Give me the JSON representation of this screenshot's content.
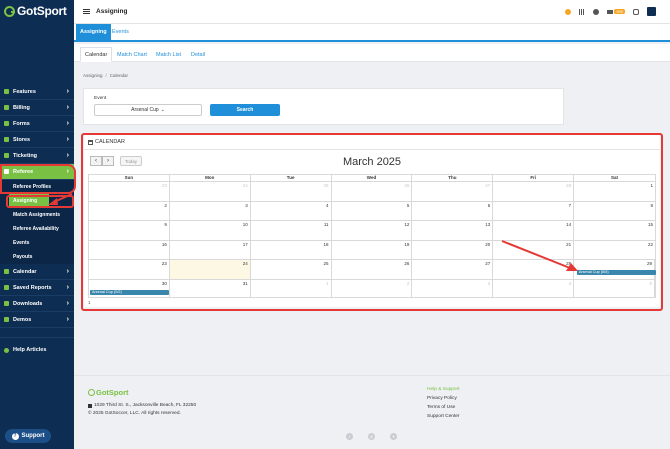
{
  "brand": {
    "name": "GotSport"
  },
  "sidebar": {
    "items": [
      {
        "label": "Features"
      },
      {
        "label": "Billing"
      },
      {
        "label": "Forms"
      },
      {
        "label": "Stores"
      },
      {
        "label": "Ticketing"
      },
      {
        "label": "Referee"
      },
      {
        "label": "Calendar"
      },
      {
        "label": "Saved Reports"
      },
      {
        "label": "Downloads"
      },
      {
        "label": "Demos"
      }
    ],
    "referee_sub": [
      {
        "label": "Referee Profiles"
      },
      {
        "label": "Assigning"
      },
      {
        "label": "Match Assignments"
      },
      {
        "label": "Referee Availability"
      },
      {
        "label": "Events"
      },
      {
        "label": "Payouts"
      }
    ],
    "help": "Help Articles",
    "support": "Support"
  },
  "topbar": {
    "title": "Assigning",
    "mail_badge": "999"
  },
  "tabs_primary": [
    {
      "label": "Assigning"
    },
    {
      "label": "Events"
    }
  ],
  "tabs_secondary": [
    {
      "label": "Calendar"
    },
    {
      "label": "Match Chart"
    },
    {
      "label": "Match List"
    },
    {
      "label": "Detail"
    }
  ],
  "breadcrumb": [
    "Assigning",
    "Calendar"
  ],
  "event_filter": {
    "label": "Event",
    "selected": "Arsenal Cup",
    "search_label": "Search"
  },
  "calendar": {
    "heading": "CALENDAR",
    "prev": "‹",
    "next": "›",
    "today_label": "Today",
    "month_title": "March 2025",
    "days_of_week": [
      "Sun",
      "Mon",
      "Tue",
      "Wed",
      "Thu",
      "Fri",
      "Sat"
    ],
    "weeks": [
      [
        {
          "d": "23",
          "o": true
        },
        {
          "d": "24",
          "o": true
        },
        {
          "d": "25",
          "o": true
        },
        {
          "d": "26",
          "o": true
        },
        {
          "d": "27",
          "o": true
        },
        {
          "d": "28",
          "o": true
        },
        {
          "d": "1"
        }
      ],
      [
        {
          "d": "2"
        },
        {
          "d": "3"
        },
        {
          "d": "4"
        },
        {
          "d": "5"
        },
        {
          "d": "6"
        },
        {
          "d": "7"
        },
        {
          "d": "8"
        }
      ],
      [
        {
          "d": "9"
        },
        {
          "d": "10"
        },
        {
          "d": "11"
        },
        {
          "d": "12"
        },
        {
          "d": "13"
        },
        {
          "d": "14"
        },
        {
          "d": "15"
        }
      ],
      [
        {
          "d": "16"
        },
        {
          "d": "17"
        },
        {
          "d": "18"
        },
        {
          "d": "19"
        },
        {
          "d": "20"
        },
        {
          "d": "21"
        },
        {
          "d": "22"
        }
      ],
      [
        {
          "d": "23"
        },
        {
          "d": "24",
          "t": true
        },
        {
          "d": "25"
        },
        {
          "d": "26"
        },
        {
          "d": "27"
        },
        {
          "d": "28"
        },
        {
          "d": "29"
        }
      ],
      [
        {
          "d": "30"
        },
        {
          "d": "31"
        },
        {
          "d": "1",
          "o": true
        },
        {
          "d": "2",
          "o": true
        },
        {
          "d": "3",
          "o": true
        },
        {
          "d": "4",
          "o": true
        },
        {
          "d": "5",
          "o": true
        }
      ]
    ],
    "events": [
      {
        "title": "Arsenal Cup (8/8)",
        "week": 4,
        "day": 6
      },
      {
        "title": "Arsenal Cup (0/2)",
        "week": 5,
        "day": 0
      }
    ],
    "more": "1"
  },
  "footer": {
    "brand": "GotSport",
    "address": "1029 Third St. S., Jacksonville Beach, FL 32250",
    "copyright": "© 2025 GotSoccer, LLC. All rights reserved.",
    "links_head": "Help & Support",
    "links": [
      "Privacy Policy",
      "Terms of Use",
      "Support Center"
    ],
    "social": [
      "f",
      "◎",
      "✦"
    ]
  },
  "colors": {
    "navy": "#0d2d52",
    "green": "#7ac143",
    "blue": "#1f8fd9",
    "annotation": "#e53935",
    "event": "#3a87ad"
  }
}
